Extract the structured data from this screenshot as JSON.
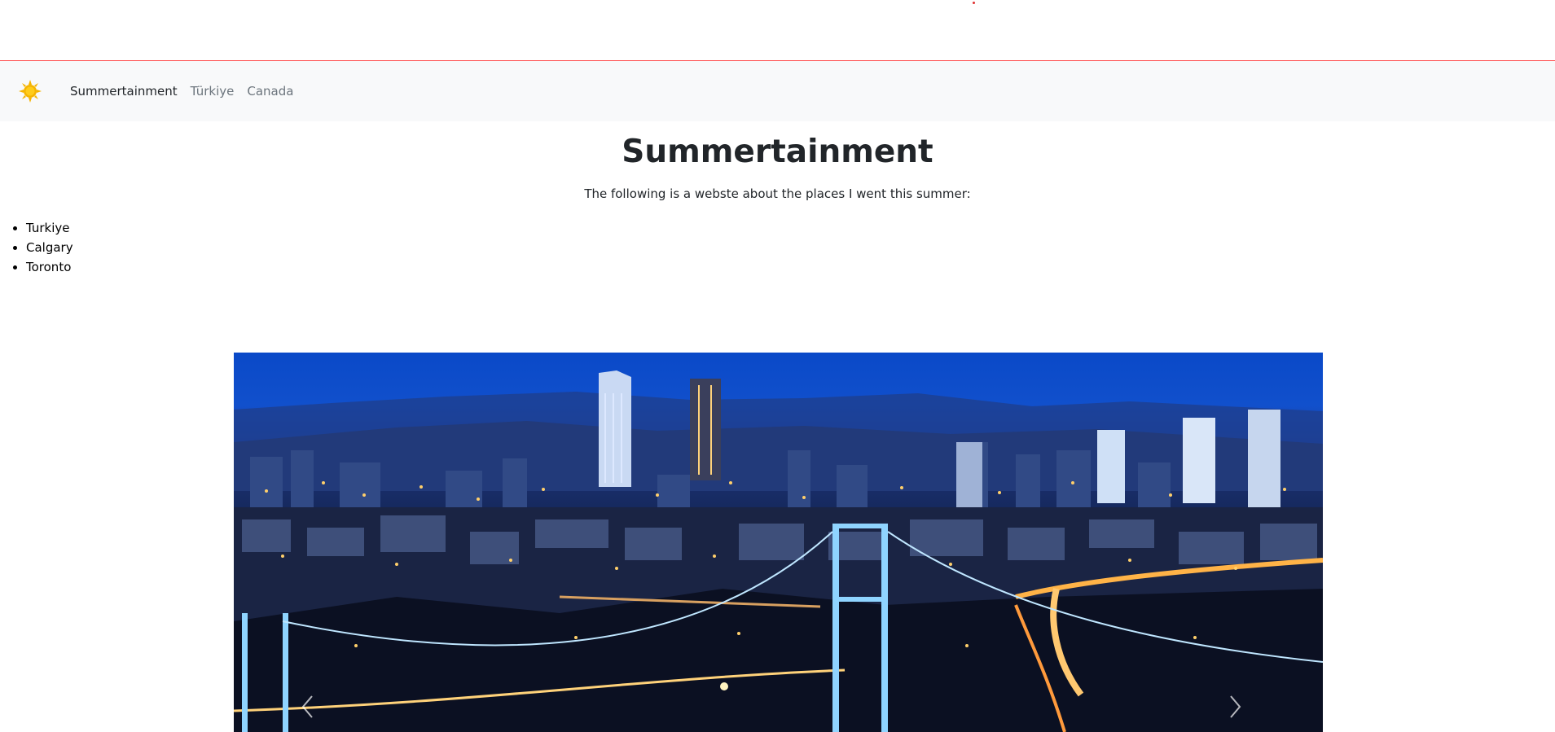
{
  "navbar": {
    "brand_icon": "sun-icon",
    "links": [
      {
        "label": "Summertainment",
        "active": true
      },
      {
        "label": "Türkiye",
        "active": false
      },
      {
        "label": "Canada",
        "active": false
      }
    ]
  },
  "main": {
    "title": "Summertainment",
    "intro": "The following is a webste about the places I went this summer:",
    "places": [
      "Turkiye",
      "Calgary",
      "Toronto"
    ]
  },
  "carousel": {
    "image": "istanbul-night-skyline",
    "prev_icon": "chevron-left-icon",
    "next_icon": "chevron-right-icon"
  },
  "colors": {
    "nav_bg": "#f8f9fa",
    "divider": "#ff4d4d",
    "sun": "#f5b400"
  }
}
